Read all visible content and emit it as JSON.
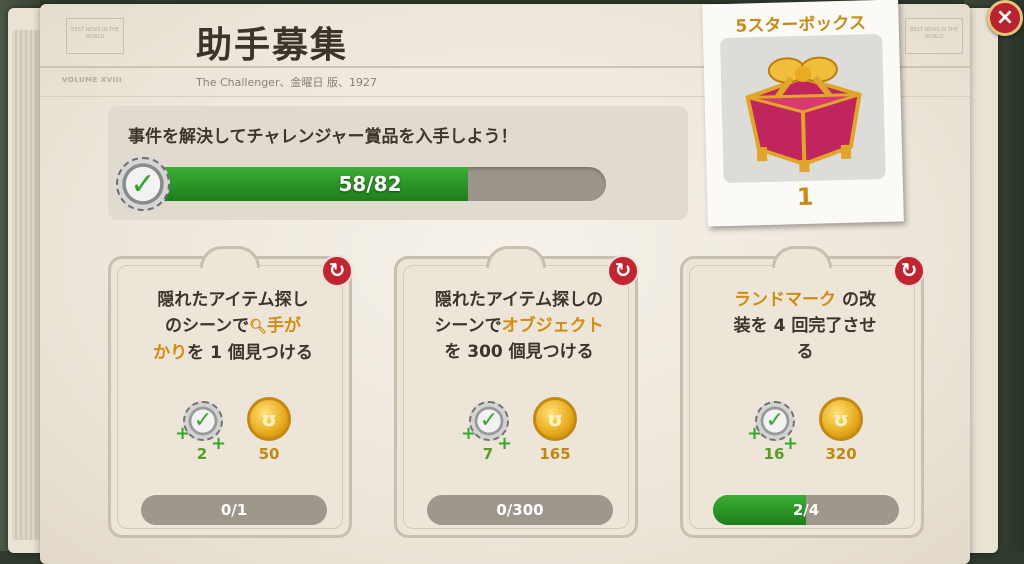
{
  "header": {
    "title": "助手募集",
    "subline": "The Challenger、金曜日 版、1927",
    "masthead_left_1": "BEST NEWS IN THE WORLD",
    "masthead_left_2": "VOLUME XVIII",
    "masthead_right": "BEST NEWS IN THE WORLD"
  },
  "goal": {
    "text": "事件を解決してチャレンジャー賞品を入手しよう！",
    "progress_label": "58/82",
    "progress_fraction": 0.707
  },
  "reward": {
    "title": "5スターボックス",
    "count": "1"
  },
  "close_icon": "×",
  "refresh_icon": "↻",
  "badge_icon": "✓",
  "plus_icon": "+",
  "coin_icon": "ʊ",
  "tasks": [
    {
      "line1": "隠れたアイテム探し",
      "line2a": "のシーンで",
      "line2_hl": "手が",
      "line3_hl": "かり",
      "line3b": "を 1 個見つける",
      "reward_badge": "2",
      "reward_coins": "50",
      "progress_label": "0/1",
      "progress_fraction": 0
    },
    {
      "line1": "隠れたアイテム探しの",
      "line2a": "シーンで",
      "line2_hl": "オブジェクト",
      "line3b": "を 300 個見つける",
      "reward_badge": "7",
      "reward_coins": "165",
      "progress_label": "0/300",
      "progress_fraction": 0
    },
    {
      "line1_hl": "ランドマーク",
      "line1b": " の改",
      "line2": "装を 4 回完了させ",
      "line3": "る",
      "reward_badge": "16",
      "reward_coins": "320",
      "progress_label": "2/4",
      "progress_fraction": 0.5
    }
  ],
  "colors": {
    "accent_green": "#2e9a2a",
    "highlight_gold": "#d28c12",
    "close_red": "#b7232e"
  }
}
